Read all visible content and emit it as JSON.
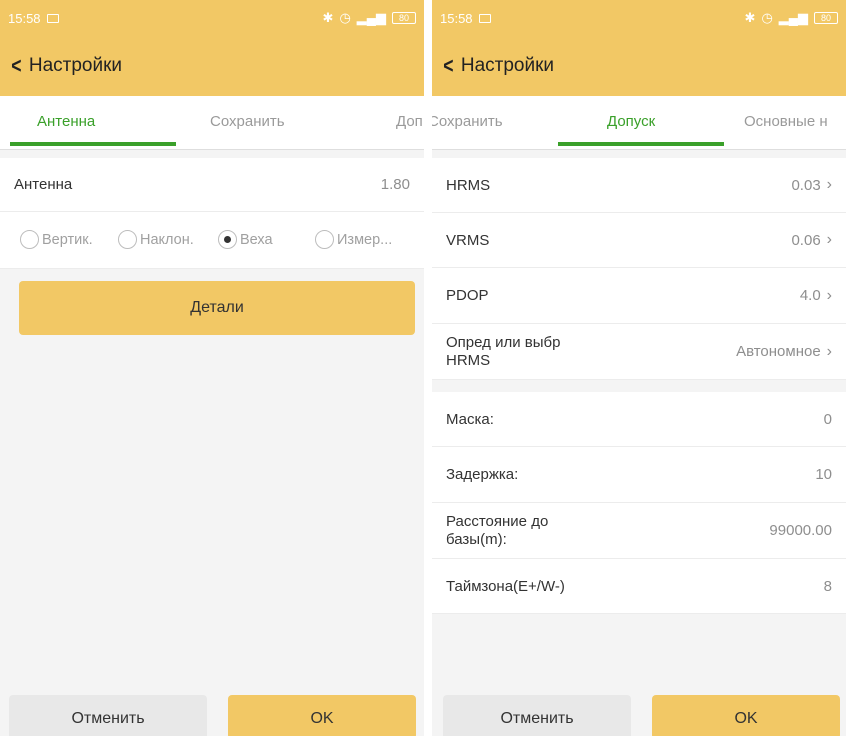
{
  "left": {
    "status": {
      "time": "15:58",
      "battery": "80"
    },
    "header": {
      "back": "<",
      "title": "Настройки"
    },
    "tabs": [
      "Антенна",
      "Сохранить",
      "Доп"
    ],
    "antenna": {
      "label": "Антенна",
      "value": "1.80"
    },
    "radios": [
      {
        "label": "Вертик.",
        "selected": false
      },
      {
        "label": "Наклон.",
        "selected": false
      },
      {
        "label": "Веха",
        "selected": true
      },
      {
        "label": "Измер...",
        "selected": false
      }
    ],
    "details_label": "Детали",
    "cancel_label": "Отменить",
    "ok_label": "OK"
  },
  "right": {
    "status": {
      "time": "15:58",
      "battery": "80"
    },
    "header": {
      "back": "<",
      "title": "Настройки"
    },
    "tabs": [
      "Сохранить",
      "Допуск",
      "Основные н"
    ],
    "rows": [
      {
        "label": "HRMS",
        "value": "0.03"
      },
      {
        "label": "VRMS",
        "value": "0.06"
      },
      {
        "label": "PDOP",
        "value": "4.0"
      },
      {
        "label": "Опред или выбр HRMS",
        "value": "Автономное"
      },
      {
        "label": "Маска:",
        "value": "0"
      },
      {
        "label": "Задержка:",
        "value": "10"
      },
      {
        "label": "Расстояние до базы(m):",
        "value": "99000.00"
      },
      {
        "label": "Таймзона(E+/W-)",
        "value": "8"
      }
    ],
    "cancel_label": "Отменить",
    "ok_label": "OK"
  },
  "colors": {
    "accent": "#3aa02a",
    "header": "#f2c865",
    "background": "#f4f4f4"
  }
}
